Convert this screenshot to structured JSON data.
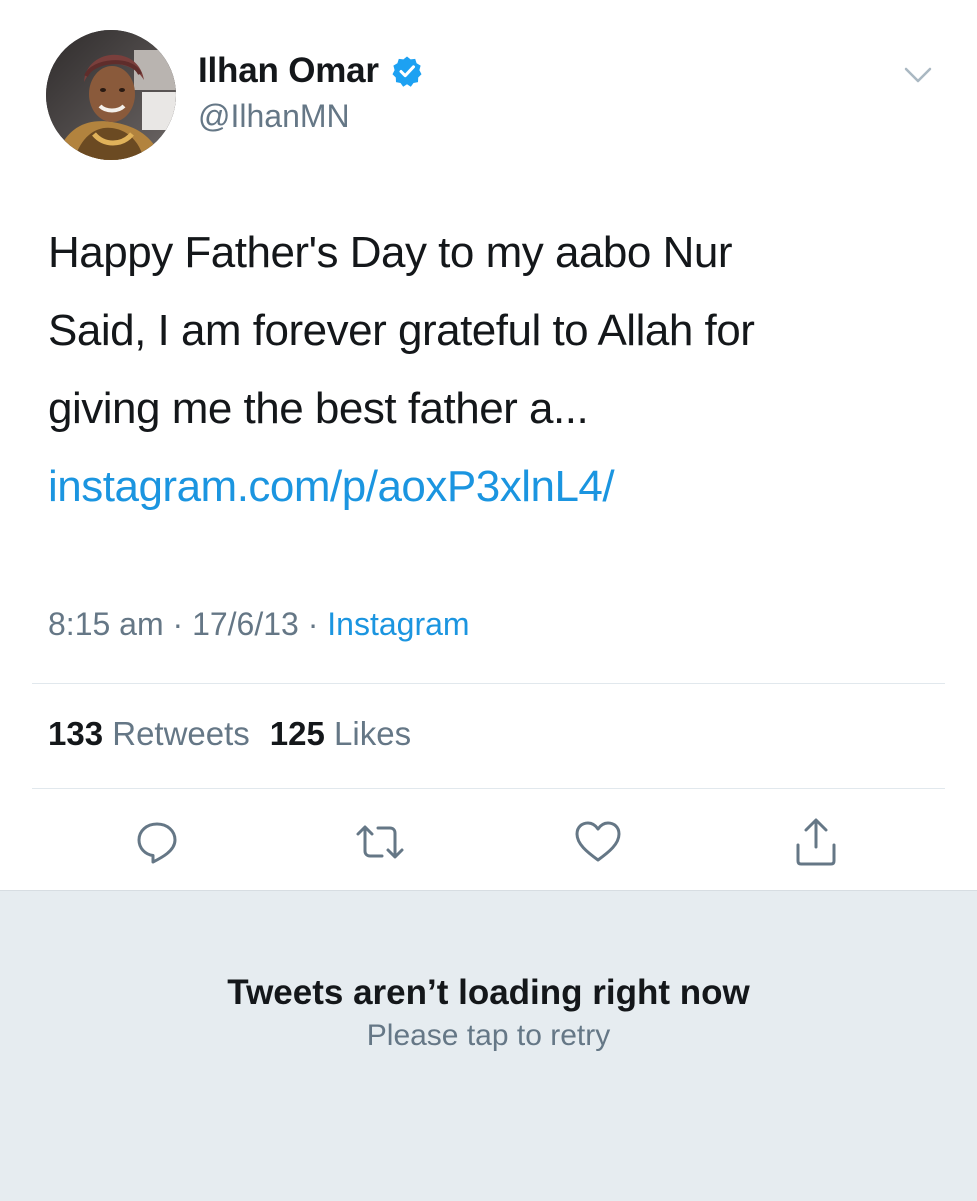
{
  "author": {
    "display_name": "Ilhan Omar",
    "handle": "@IlhanMN",
    "verified": true
  },
  "tweet": {
    "text_lines": [
      "Happy Father's Day to my aabo Nur",
      "Said, I am forever grateful to Allah for",
      "giving me the best father a..."
    ],
    "link_text": "instagram.com/p/aoxP3xlnL4/",
    "time": "8:15 am",
    "date": "17/6/13",
    "separator": "·",
    "source": "Instagram"
  },
  "stats": {
    "retweets_count": "133",
    "retweets_label": "Retweets",
    "likes_count": "125",
    "likes_label": "Likes"
  },
  "actions": [
    {
      "icon": "reply-icon"
    },
    {
      "icon": "retweet-icon"
    },
    {
      "icon": "like-icon"
    },
    {
      "icon": "share-icon"
    }
  ],
  "error": {
    "title": "Tweets aren’t loading right now",
    "subtitle": "Please tap to retry"
  },
  "colors": {
    "link": "#1b95e0",
    "text": "#14171a",
    "secondary": "#657786",
    "divider": "#e1e8ed",
    "panel_bg": "#e6ecf0",
    "verified": "#1da1f2"
  }
}
